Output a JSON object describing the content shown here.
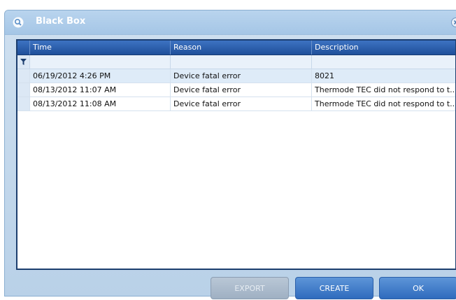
{
  "window": {
    "title": "Black Box"
  },
  "grid": {
    "columns": [
      "Time",
      "Reason",
      "Description"
    ],
    "rows": [
      {
        "time": "06/19/2012 4:26 PM",
        "reason": "Device fatal error",
        "description": "8021"
      },
      {
        "time": "08/13/2012 11:07 AM",
        "reason": "Device fatal error",
        "description": "Thermode TEC did not respond to t..."
      },
      {
        "time": "08/13/2012 11:08 AM",
        "reason": "Device fatal error",
        "description": "Thermode TEC did not respond to t..."
      }
    ]
  },
  "buttons": {
    "export": "EXPORT",
    "create": "CREATE",
    "ok": "OK"
  },
  "icons": {
    "title": "magnifier-icon",
    "close": "close-icon",
    "filter": "filter-icon"
  },
  "colors": {
    "header": "#1f4f9a",
    "frame": "#1c3e6e",
    "button": "#2f6bbd"
  }
}
